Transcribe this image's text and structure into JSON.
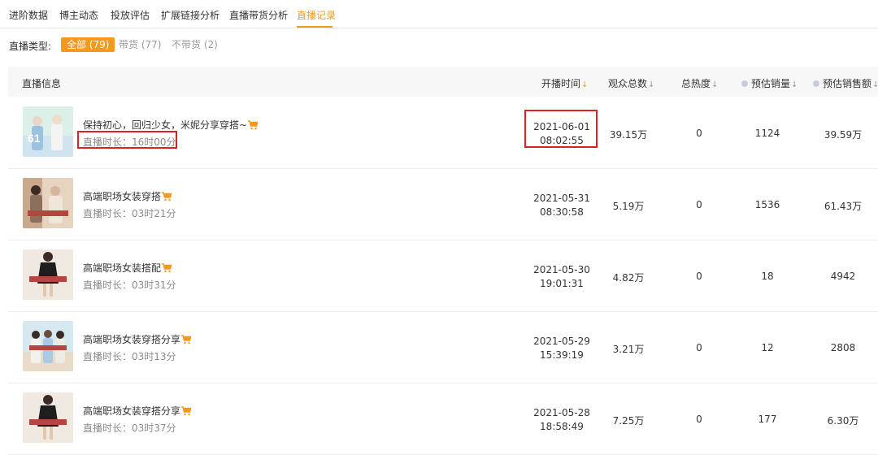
{
  "tabs": [
    {
      "label": "进阶数据"
    },
    {
      "label": "博主动态"
    },
    {
      "label": "投放评估"
    },
    {
      "label": "扩展链接分析"
    },
    {
      "label": "直播带货分析"
    },
    {
      "label": "直播记录"
    }
  ],
  "active_tab": "直播记录",
  "filter": {
    "label": "直播类型:",
    "options": [
      {
        "label": "全部 (79)"
      },
      {
        "label": "带货 (77)"
      },
      {
        "label": "不带货 (2)"
      }
    ],
    "selected": "全部 (79)"
  },
  "table": {
    "columns": [
      {
        "label": "直播信息"
      },
      {
        "label": "开播时间"
      },
      {
        "label": "观众总数"
      },
      {
        "label": "总热度"
      },
      {
        "label": "预估销量"
      },
      {
        "label": "预估销售额"
      }
    ],
    "rows": [
      {
        "title": "保持初心，回归少女，米妮分享穿搭~",
        "duration": "直播时长：16时00分",
        "date": "2021-06-01",
        "time": "08:02:55",
        "viewers": "39.15万",
        "heat": "0",
        "sales": "1124",
        "amount": "39.59万"
      },
      {
        "title": "高端职场女装穿搭",
        "duration": "直播时长：03时21分",
        "date": "2021-05-31",
        "time": "08:30:58",
        "viewers": "5.19万",
        "heat": "0",
        "sales": "1536",
        "amount": "61.43万"
      },
      {
        "title": "高端职场女装搭配",
        "duration": "直播时长：03时31分",
        "date": "2021-05-30",
        "time": "19:01:31",
        "viewers": "4.82万",
        "heat": "0",
        "sales": "18",
        "amount": "4942"
      },
      {
        "title": "高端职场女装穿搭分享",
        "duration": "直播时长：03时13分",
        "date": "2021-05-29",
        "time": "15:39:19",
        "viewers": "3.21万",
        "heat": "0",
        "sales": "12",
        "amount": "2808"
      },
      {
        "title": "高端职场女装穿搭分享",
        "duration": "直播时长：03时37分",
        "date": "2021-05-28",
        "time": "18:58:49",
        "viewers": "7.25万",
        "heat": "0",
        "sales": "177",
        "amount": "6.30万"
      }
    ]
  },
  "colors": {
    "accent": "#f39a1c",
    "highlight_box": "#e02020",
    "header_bg": "#f7f7f7"
  },
  "icons": {
    "cart": "shopping-cart-icon",
    "sort": "sort-down-icon",
    "info": "info-dot-icon"
  }
}
